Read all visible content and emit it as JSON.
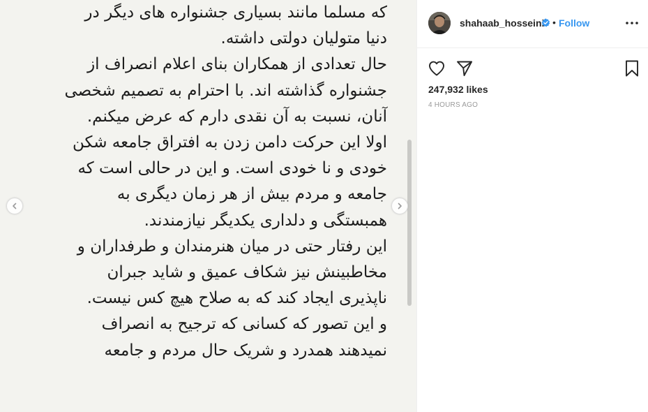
{
  "post": {
    "body_lines": [
      "که مسلما مانند بسیاری جشنواره های دیگر در",
      "دنیا متولیان دولتی داشته.",
      "حال تعدادی از همکاران بنای اعلام انصراف از",
      "جشنواره گذاشته اند. با احترام به تصمیم شخصی",
      "آنان، نسبت به آن نقدی دارم که عرض میکنم.",
      "اولا این حرکت دامن زدن به افتراق جامعه شکن",
      "خودی و نا خودی است. و این در حالی است که",
      "جامعه و مردم بیش از هر زمان دیگری به",
      "همبستگی و دلداری یکدیگر نیازمندند.",
      "این رفتار حتی در میان هنرمندان و طرفداران و",
      "مخاطبینش نیز شکاف عمیق و شاید جبران",
      "ناپذیری ایجاد کند که به صلاح هیچ کس نیست.",
      "و این تصور که کسانی که ترجیح به انصراف",
      "نمیدهند همدرد و شریک حال مردم و جامعه"
    ]
  },
  "header": {
    "username": "shahaab_hosseini",
    "separator": "•",
    "follow_label": "Follow"
  },
  "stats": {
    "likes": "247,932 likes",
    "timestamp": "4 HOURS AGO"
  },
  "colors": {
    "accent": "#3897f0",
    "verified": "#3897f0",
    "media_bg": "#f3f3ef",
    "text": "#262626",
    "muted": "#999999"
  },
  "icons": {
    "verified": "verified-badge-icon",
    "more": "more-options-icon",
    "like": "heart-icon",
    "share": "paper-plane-icon",
    "save": "bookmark-icon",
    "prev": "chevron-left-icon",
    "next": "chevron-right-icon"
  }
}
